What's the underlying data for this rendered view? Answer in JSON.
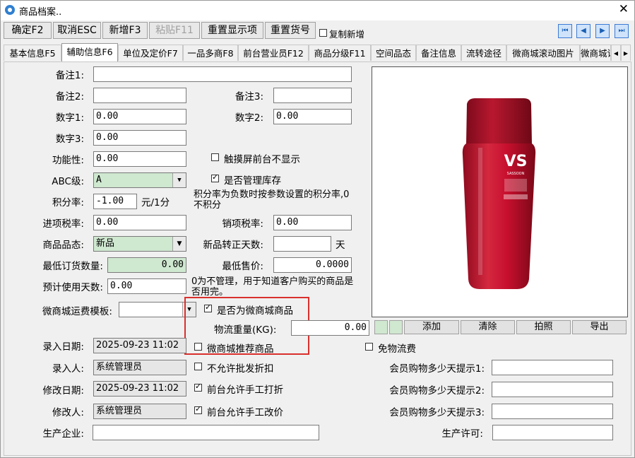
{
  "window": {
    "title": "商品档案..",
    "close": "✕"
  },
  "toolbar": {
    "confirm": "确定F2",
    "cancel": "取消ESC",
    "add": "新增F3",
    "paste": "粘贴F11",
    "reset_display": "重置显示项",
    "reset_code": "重置货号",
    "copy_new": "复制新增",
    "nav": [
      "⏮",
      "◀",
      "▶",
      "⏭"
    ]
  },
  "tabs": [
    "基本信息F5",
    "辅助信息F6",
    "单位及定价F7",
    "一品多商F8",
    "前台营业员F12",
    "商品分级F11",
    "空间品态",
    "备注信息",
    "流转途径",
    "微商城滚动图片",
    "微商城详情"
  ],
  "tab_scroll": [
    "◀",
    "▶"
  ],
  "form": {
    "note1": {
      "label": "备注1:",
      "value": ""
    },
    "note2": {
      "label": "备注2:",
      "value": ""
    },
    "note3": {
      "label": "备注3:",
      "value": ""
    },
    "num1": {
      "label": "数字1:",
      "value": "0.00"
    },
    "num2": {
      "label": "数字2:",
      "value": "0.00"
    },
    "num3": {
      "label": "数字3:",
      "value": "0.00"
    },
    "func": {
      "label": "功能性:",
      "value": "0.00"
    },
    "touch_hide": {
      "label": "触摸屏前台不显示",
      "checked": false
    },
    "abc": {
      "label": "ABC级:",
      "value": "A"
    },
    "manage_stock": {
      "label": "是否管理库存",
      "checked": true
    },
    "points": {
      "label": "积分率:",
      "value": "-1.00",
      "unit": "元/1分"
    },
    "points_note": "积分率为负数时按参数设置的积分率,0不积分",
    "in_tax": {
      "label": "进项税率:",
      "value": "0.00"
    },
    "out_tax": {
      "label": "销项税率:",
      "value": "0.00"
    },
    "state": {
      "label": "商品品态:",
      "value": "新品"
    },
    "new_days": {
      "label": "新品转正天数:",
      "value": "",
      "unit": "天"
    },
    "min_order": {
      "label": "最低订货数量:",
      "value": "0.00"
    },
    "min_price": {
      "label": "最低售价:",
      "value": "0.0000"
    },
    "use_days": {
      "label": "预计使用天数:",
      "value": "0.00"
    },
    "use_days_note": "0为不管理，用于知道客户购买的商品是否用完。",
    "freight": {
      "label": "微商城运费模板:",
      "value": ""
    },
    "is_mall": {
      "label": "是否为微商城商品",
      "checked": true
    },
    "weight": {
      "label": "物流重量(KG):",
      "value": "0.00"
    },
    "mall_recommend": {
      "label": "微商城推荐商品",
      "checked": false
    },
    "free_ship": {
      "label": "免物流费",
      "checked": false
    },
    "entry_date": {
      "label": "录入日期:",
      "value": "2025-09-23 11:02"
    },
    "entry_user": {
      "label": "录入人:",
      "value": "系统管理员"
    },
    "no_discount": {
      "label": "不允许批发折扣",
      "checked": false
    },
    "mod_date": {
      "label": "修改日期:",
      "value": "2025-09-23 11:02"
    },
    "manual_discount": {
      "label": "前台允许手工打折",
      "checked": true
    },
    "mod_user": {
      "label": "修改人:",
      "value": "系统管理员"
    },
    "manual_price": {
      "label": "前台允许手工改价",
      "checked": true
    },
    "remind1": {
      "label": "会员购物多少天提示1:",
      "value": ""
    },
    "remind2": {
      "label": "会员购物多少天提示2:",
      "value": ""
    },
    "remind3": {
      "label": "会员购物多少天提示3:",
      "value": ""
    },
    "producer": {
      "label": "生产企业:",
      "value": ""
    },
    "license": {
      "label": "生产许可:",
      "value": ""
    }
  },
  "image_buttons": {
    "add": "添加",
    "clear": "清除",
    "photo": "拍照",
    "export": "导出"
  },
  "product_image": {
    "brand": "VS",
    "brand_sub": "SASSOON",
    "colors": {
      "bottle": "#c8102e",
      "cap": "#a50d26"
    }
  }
}
